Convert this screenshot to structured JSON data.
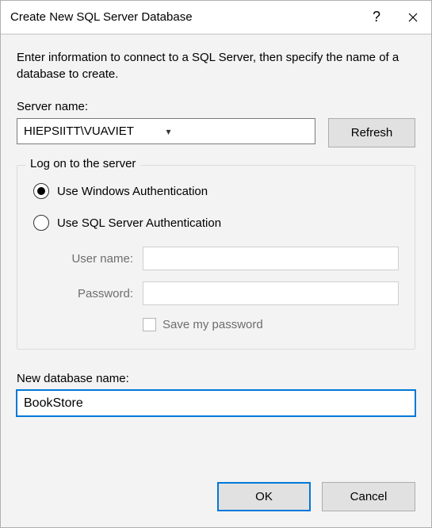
{
  "titlebar": {
    "title": "Create New SQL Server Database",
    "help_icon": "help-icon",
    "close_icon": "close-icon"
  },
  "intro": "Enter information to connect to a SQL Server, then specify the name of a database to create.",
  "server": {
    "label": "Server name:",
    "value": "HIEPSIITT\\VUAVIET",
    "refresh": "Refresh"
  },
  "logon": {
    "legend": "Log on to the server",
    "windows_auth": "Use Windows Authentication",
    "sql_auth": "Use SQL Server Authentication",
    "username_label": "User name:",
    "username_value": "",
    "password_label": "Password:",
    "password_value": "",
    "save_password": "Save my password"
  },
  "dbname": {
    "label": "New database name:",
    "value": "BookStore"
  },
  "footer": {
    "ok": "OK",
    "cancel": "Cancel"
  }
}
